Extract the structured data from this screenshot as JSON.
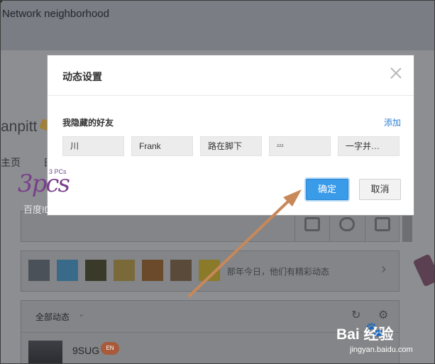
{
  "background": {
    "network_title": "Network neighborhood",
    "profile_name": "anpitt",
    "nav_home": "主页",
    "nav_second": "日",
    "photos_prompt": "那年今日，他们有精彩动态",
    "feed_filter": "全部动态",
    "feed_user": "9SUG",
    "feed_badge": "EN"
  },
  "dialog": {
    "title": "动态设置",
    "section_label": "我隐藏的好友",
    "add_label": "添加",
    "friends": [
      "川",
      "Frank",
      "路在脚下",
      "ᶻᶻᶻ",
      "一字并…"
    ],
    "ok_label": "确定",
    "cancel_label": "取消"
  },
  "watermark": {
    "logo_text": "3pcs",
    "logo_small": "3 PCs",
    "id_text": "百度ID: Sanpitt",
    "baidu_logo": "Bai 经验",
    "baidu_url": "jingyan.baidu.com"
  },
  "colors": {
    "accent": "#3a9be8",
    "link": "#2d7fd4",
    "arrow": "#c8885a"
  }
}
